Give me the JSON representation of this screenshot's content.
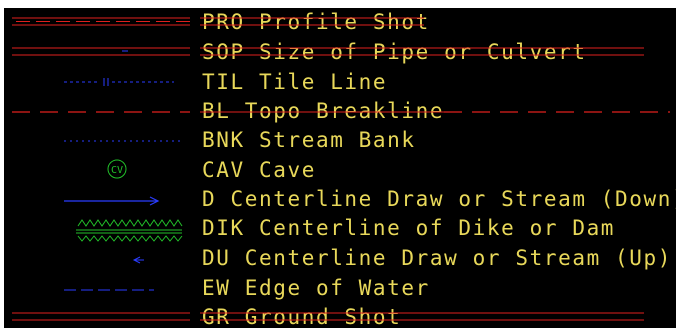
{
  "colors": {
    "background": "#000000",
    "label_text": "#e8d85a",
    "red_line": "#e0201e",
    "blue_line": "#2a3cff",
    "green_symbol": "#22c02a"
  },
  "legend": {
    "rows": [
      {
        "label": "PRO Profile Shot",
        "symbol": "red-dashed-line"
      },
      {
        "label": "SOP Size of Pipe or Culvert",
        "symbol": "red-double-line"
      },
      {
        "label": "TIL Tile Line",
        "symbol": "blue-short-line"
      },
      {
        "label": "BL Topo Breakline",
        "symbol": "red-dash-line"
      },
      {
        "label": "BNK Stream Bank",
        "symbol": "blue-dotted-line"
      },
      {
        "label": "CAV Cave",
        "symbol": "green-cave-icon",
        "icon_text": "CV"
      },
      {
        "label": "D Centerline Draw or Stream (Down)",
        "symbol": "blue-arrow-line"
      },
      {
        "label": "DIK Centerline of Dike or Dam",
        "symbol": "green-dike-line"
      },
      {
        "label": "DU Centerline Draw or Stream (Up)",
        "symbol": "blue-up-marker"
      },
      {
        "label": "EW Edge of Water",
        "symbol": "blue-dashed-line"
      },
      {
        "label": "GR Ground Shot",
        "symbol": "red-double-line"
      }
    ]
  }
}
